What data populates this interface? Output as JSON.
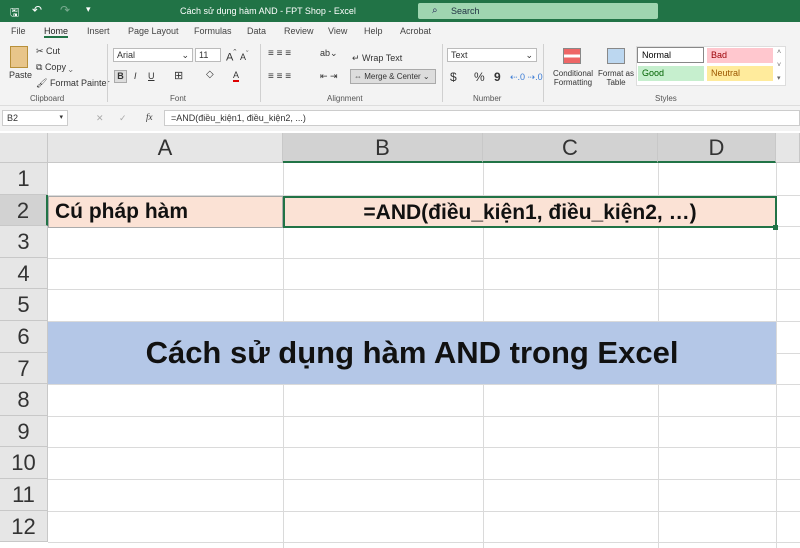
{
  "title_bar": {
    "title": "Cách sử dụng hàm AND - FPT Shop  -  Excel",
    "search_placeholder": "Search"
  },
  "tabs": [
    "File",
    "Home",
    "Insert",
    "Page Layout",
    "Formulas",
    "Data",
    "Review",
    "View",
    "Help",
    "Acrobat"
  ],
  "ribbon": {
    "clipboard": {
      "paste": "Paste",
      "cut": "Cut",
      "copy": "Copy",
      "format_painter": "Format Painter",
      "label": "Clipboard"
    },
    "font": {
      "name": "Arial",
      "size": "11",
      "bold": "B",
      "italic": "I",
      "underline": "U",
      "label": "Font"
    },
    "alignment": {
      "wrap_text": "Wrap Text",
      "merge_center": "Merge & Center",
      "label": "Alignment"
    },
    "number": {
      "format": "Text",
      "currency": "$",
      "percent": "%",
      "comma": "9",
      "label": "Number"
    },
    "styles": {
      "conditional": "Conditional Formatting",
      "format_table": "Format as Table",
      "normal": "Normal",
      "bad": "Bad",
      "good": "Good",
      "neutral": "Neutral",
      "label": "Styles"
    }
  },
  "formula_bar": {
    "name_box": "B2",
    "fx": "fx",
    "formula": "=AND(điều_kiện1, điều_kiện2, ...)"
  },
  "columns": [
    "A",
    "B",
    "C",
    "D"
  ],
  "rows": [
    "1",
    "2",
    "3",
    "4",
    "5",
    "6",
    "7",
    "8",
    "9",
    "10",
    "11",
    "12"
  ],
  "cells": {
    "A2": "Cú pháp hàm",
    "B2": "=AND(điều_kiện1, điều_kiện2, …)",
    "A6": "Cách sử dụng hàm AND trong Excel"
  },
  "colors": {
    "accent": "#217346",
    "peach": "#fbe2d5",
    "blue": "#b4c7e7"
  }
}
